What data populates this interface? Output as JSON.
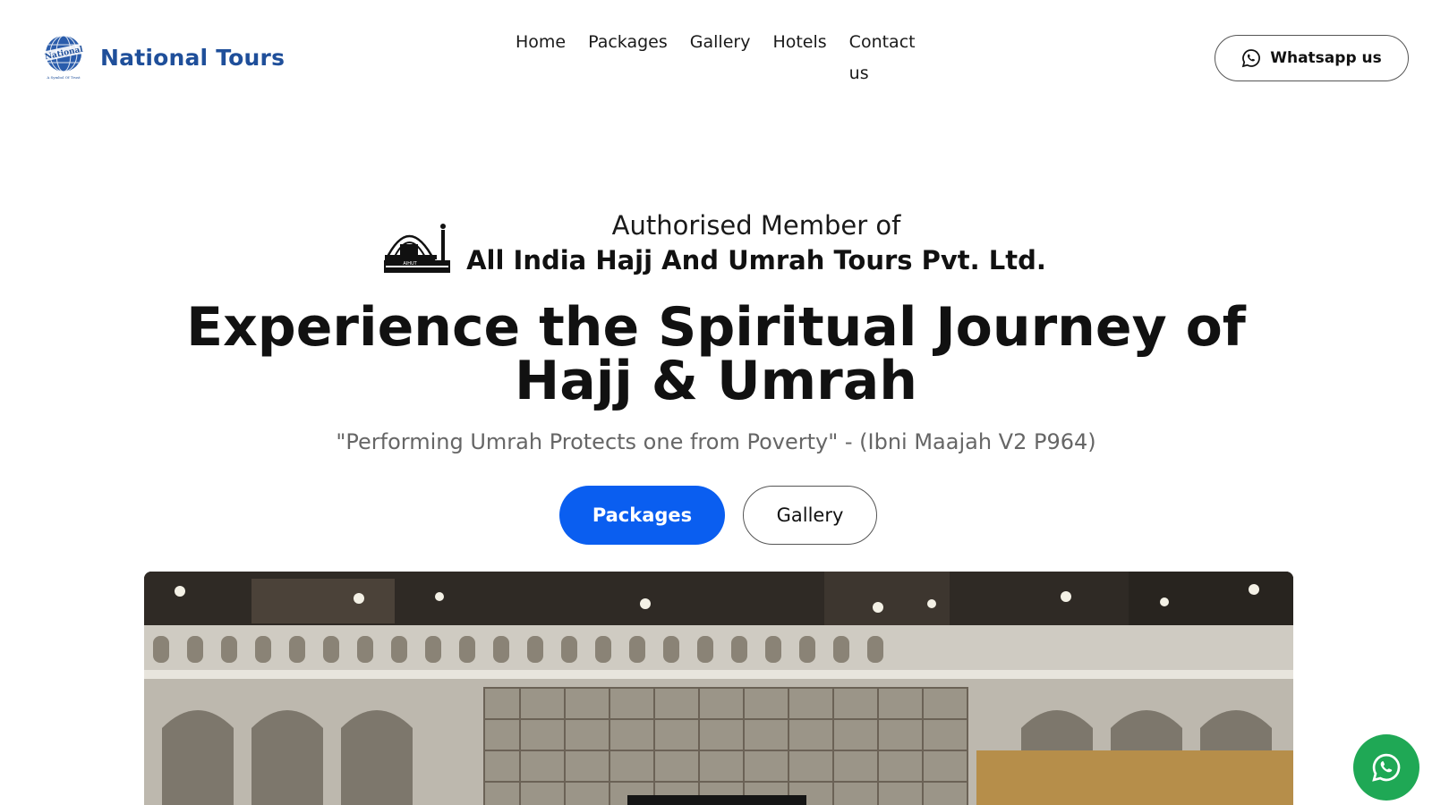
{
  "header": {
    "brand_name": "National Tours",
    "logo_text": "National",
    "logo_tagline": "A Symbol Of Trust",
    "nav": [
      "Home",
      "Packages",
      "Gallery",
      "Hotels",
      "Contact us"
    ],
    "whatsapp_label": "Whatsapp us"
  },
  "hero": {
    "member_line1": "Authorised Member of",
    "member_line2": "All India Hajj And Umrah Tours Pvt. Ltd.",
    "member_logo_text": "AIHUT",
    "title": "Experience the Spiritual Journey of Hajj & Umrah",
    "quote": "\"Performing Umrah Protects one from Poverty\" - (Ibni Maajah V2 P964)",
    "primary_button": "Packages",
    "secondary_button": "Gallery"
  },
  "icons": {
    "whatsapp": "whatsapp-icon",
    "float": "whatsapp-icon"
  },
  "colors": {
    "brand": "#1f4f9a",
    "primary": "#0a5ef0",
    "whatsapp_green": "#1fa855"
  }
}
